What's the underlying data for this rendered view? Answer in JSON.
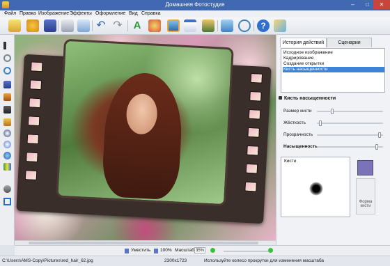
{
  "window": {
    "title": "Домашняя Фотостудия",
    "minimize": "–",
    "maximize": "□",
    "close": "✕"
  },
  "menu": [
    "Файл",
    "Правка",
    "Изображение",
    "Эффекты",
    "Оформление",
    "Вид",
    "Справка"
  ],
  "toolbar_icons": [
    "open-icon",
    "palette-icon",
    "save-icon",
    "print-icon",
    "export-icon",
    "undo-icon",
    "redo-icon",
    "text-icon",
    "effects-icon",
    "frame-icon",
    "calendar-icon",
    "collage-icon",
    "fullscreen-icon",
    "zoom-icon",
    "help-icon",
    "box-icon"
  ],
  "tools": [
    "pointer-tool",
    "rotate-tool",
    "zoom-tool",
    "pen-tool",
    "brush-tool",
    "stamp-tool",
    "fill-tool",
    "dodge-tool",
    "eye-tool",
    "burn-tool",
    "saturation-tool",
    "gradient-tool",
    "crop-tool"
  ],
  "tabs": {
    "history": "История действий",
    "scenarios": "Сценарии"
  },
  "history": [
    "Исходное изображение",
    "Кадрирование",
    "Создание открытки",
    "Кисть насыщенности"
  ],
  "panel": {
    "title": "Кисть насыщенности",
    "sliders": [
      {
        "label": "Размер кисти",
        "value": 0.22
      },
      {
        "label": "Жёсткость",
        "value": 0.03
      },
      {
        "label": "Прозрачность",
        "value": 0.97
      },
      {
        "label": "Насыщенность",
        "value": 0.92
      }
    ],
    "brush_label": "Кисти",
    "shape_button": "Форма кисти"
  },
  "bottom": {
    "fit": "Уместить",
    "zoom100": "100%",
    "scale_label": "Масштаб:",
    "scale_value": "35%"
  },
  "status": {
    "path": "C:\\Users\\AMS-Copy\\Pictures\\red_hair_62.jpg",
    "size": "2300x1723",
    "hint": "Используйте колесо прокрутки для изменения масштаба"
  },
  "colors": {
    "titlebar": "#4169b1",
    "selection": "#3d84d6",
    "swatch": "#7a73b7"
  }
}
